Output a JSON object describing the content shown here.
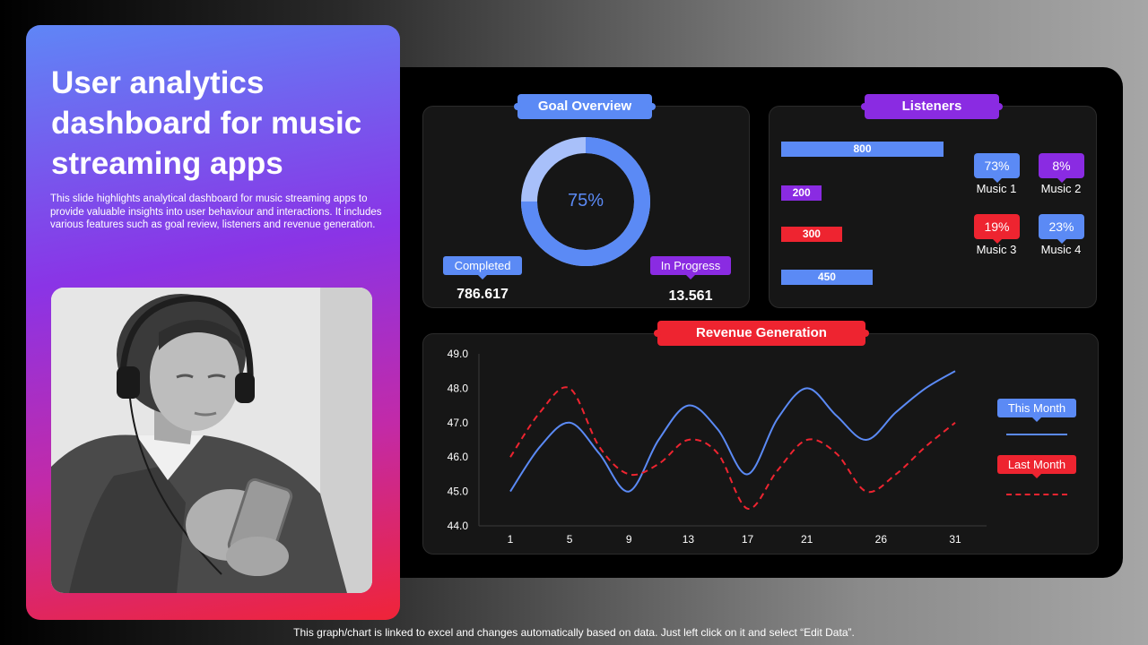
{
  "left": {
    "title": "User analytics dashboard for music streaming apps",
    "description": "This slide highlights analytical dashboard for music streaming apps to provide valuable insights into user behaviour and interactions. It includes various features such as goal review, listeners and revenue generation."
  },
  "goal": {
    "title": "Goal Overview",
    "percent_label": "75%",
    "percent": 75,
    "completed_label": "Completed",
    "completed_value": "786.617",
    "progress_label": "In Progress",
    "progress_value": "13.561",
    "colors": {
      "completed": "#5b8af5",
      "remaining": "#a8c0fa"
    }
  },
  "listeners": {
    "title": "Listeners",
    "bars": [
      {
        "value": 800,
        "color": "#5b8af5"
      },
      {
        "value": 200,
        "color": "#8a2be2"
      },
      {
        "value": 300,
        "color": "#ee2430"
      },
      {
        "value": 450,
        "color": "#5b8af5"
      }
    ],
    "shares": [
      {
        "label": "Music 1",
        "percent": "73%",
        "color": "#5b8af5"
      },
      {
        "label": "Music 2",
        "percent": "8%",
        "color": "#8a2be2"
      },
      {
        "label": "Music 3",
        "percent": "19%",
        "color": "#ee2430"
      },
      {
        "label": "Music 4",
        "percent": "23%",
        "color": "#5b8af5"
      }
    ]
  },
  "revenue": {
    "title": "Revenue Generation",
    "legend_this": "This Month",
    "legend_last": "Last Month"
  },
  "chart_data": {
    "type": "line",
    "title": "Revenue Generation",
    "x": [
      1,
      3,
      5,
      7,
      9,
      11,
      13,
      15,
      17,
      19,
      21,
      23,
      25,
      27,
      29,
      31
    ],
    "x_ticks": [
      "1",
      "5",
      "9",
      "13",
      "17",
      "21",
      "26",
      "31"
    ],
    "y_ticks": [
      "49.0",
      "48.0",
      "47.0",
      "46.0",
      "45.0",
      "44.0"
    ],
    "ylim": [
      44,
      49
    ],
    "legend_position": "right",
    "series": [
      {
        "name": "This Month",
        "color": "#5b8af5",
        "style": "solid",
        "values": [
          45.0,
          46.3,
          47.0,
          46.1,
          45.0,
          46.5,
          47.5,
          46.8,
          45.5,
          47.1,
          48.0,
          47.2,
          46.5,
          47.3,
          48.0,
          48.5
        ]
      },
      {
        "name": "Last Month",
        "color": "#ee2430",
        "style": "dashed",
        "values": [
          46.0,
          47.3,
          48.0,
          46.3,
          45.5,
          45.8,
          46.5,
          46.1,
          44.5,
          45.6,
          46.5,
          46.1,
          45.0,
          45.5,
          46.3,
          47.0
        ]
      }
    ]
  },
  "footer": "This graph/chart is linked to excel and changes automatically based on data. Just left click on it and select “Edit Data”."
}
